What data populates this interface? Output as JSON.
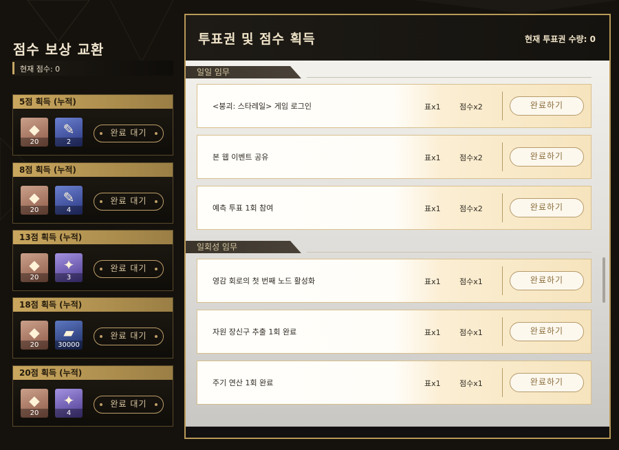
{
  "left": {
    "title": "점수 보상 교환",
    "current_score": "현재 점수: 0",
    "rewards": [
      {
        "label": "5점 획득 (누적)",
        "items": [
          {
            "icon": "crystal-icon",
            "qty": "20"
          },
          {
            "icon": "feather-icon",
            "qty": "2"
          }
        ],
        "button": "완료 대기"
      },
      {
        "label": "8점 획득 (누적)",
        "items": [
          {
            "icon": "crystal-icon",
            "qty": "20"
          },
          {
            "icon": "feather-icon",
            "qty": "4"
          }
        ],
        "button": "완료 대기"
      },
      {
        "label": "13점 획득 (누적)",
        "items": [
          {
            "icon": "crystal-icon",
            "qty": "20"
          },
          {
            "icon": "star-cube-icon",
            "qty": "3"
          }
        ],
        "button": "완료 대기"
      },
      {
        "label": "18점 획득 (누적)",
        "items": [
          {
            "icon": "crystal-icon",
            "qty": "20"
          },
          {
            "icon": "credit-chip-icon",
            "qty": "30000"
          }
        ],
        "button": "완료 대기"
      },
      {
        "label": "20점 획득 (누적)",
        "items": [
          {
            "icon": "crystal-icon",
            "qty": "20"
          },
          {
            "icon": "star-cube-icon",
            "qty": "4"
          }
        ],
        "button": "완료 대기"
      }
    ]
  },
  "right": {
    "title": "투표권 및 점수 획득",
    "vote_count": "현재 투표권 수량: 0",
    "daily_label": "일일 임무",
    "daily_tasks": [
      {
        "name": "<붕괴: 스타레일> 게임 로그인",
        "r1": "표x1",
        "r2": "점수x2",
        "button": "완료하기"
      },
      {
        "name": "본 웹 이벤트 공유",
        "r1": "표x1",
        "r2": "점수x2",
        "button": "완료하기"
      },
      {
        "name": "예측 투표 1회 참여",
        "r1": "표x1",
        "r2": "점수x2",
        "button": "완료하기"
      }
    ],
    "once_label": "일회성 임무",
    "once_tasks": [
      {
        "name": "영감 회로의 첫 번째 노드 활성화",
        "r1": "표x1",
        "r2": "점수x1",
        "button": "완료하기"
      },
      {
        "name": "자원 장신구 추출 1회 완료",
        "r1": "표x1",
        "r2": "점수x1",
        "button": "완료하기"
      },
      {
        "name": "주기 연산 1회 완료",
        "r1": "표x1",
        "r2": "점수x1",
        "button": "완료하기"
      }
    ]
  }
}
